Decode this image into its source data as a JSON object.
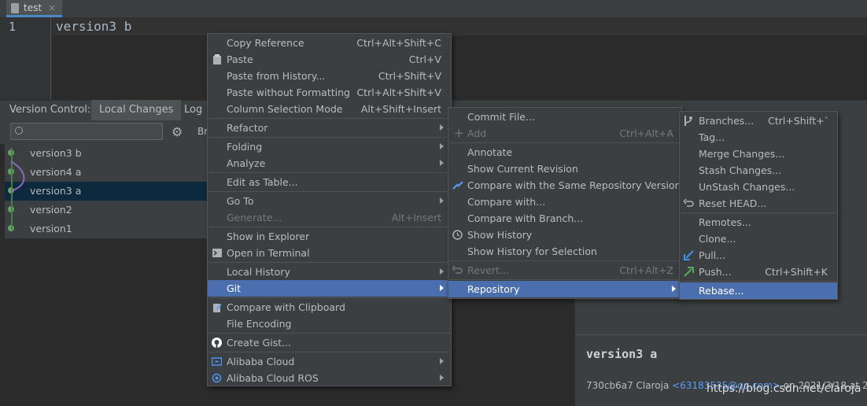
{
  "editor": {
    "tab_title": "test",
    "tab_close": "×",
    "line_number": "1",
    "line_text": "version3 b"
  },
  "version_control": {
    "title": "Version Control:",
    "tabs": [
      "Local Changes",
      "Log"
    ],
    "branch_label": "Br",
    "log": [
      {
        "message": "version3 b"
      },
      {
        "message": "version4 a"
      },
      {
        "message": "version3 a"
      },
      {
        "message": "version2"
      },
      {
        "message": "version1"
      }
    ],
    "details": {
      "title": "version3 a",
      "hash_author": "730cb6a7 Claroja",
      "email": "<63183535@qq.com>",
      "date_text": "on 2021/3/18 at 22:4"
    },
    "watermark": "https://blog.csdn.net/claroja"
  },
  "menus": {
    "main": [
      {
        "label": "Copy Reference",
        "shortcut": "Ctrl+Alt+Shift+C"
      },
      {
        "label": "Paste",
        "shortcut": "Ctrl+V",
        "icon": "clipboard-icon"
      },
      {
        "label": "Paste from History...",
        "shortcut": "Ctrl+Shift+V"
      },
      {
        "label": "Paste without Formatting",
        "shortcut": "Ctrl+Alt+Shift+V"
      },
      {
        "label": "Column Selection Mode",
        "shortcut": "Alt+Shift+Insert"
      },
      {
        "label": "Refactor",
        "submenu": true
      },
      {
        "label": "Folding",
        "submenu": true
      },
      {
        "label": "Analyze",
        "submenu": true
      },
      {
        "label": "Edit as Table..."
      },
      {
        "label": "Go To",
        "submenu": true
      },
      {
        "label": "Generate...",
        "shortcut": "Alt+Insert",
        "disabled": true
      },
      {
        "label": "Show in Explorer"
      },
      {
        "label": "Open in Terminal",
        "icon": "terminal-icon"
      },
      {
        "label": "Local History",
        "submenu": true
      },
      {
        "label": "Git",
        "submenu": true,
        "selected": true
      },
      {
        "label": "Compare with Clipboard",
        "icon": "compare-clipboard-icon"
      },
      {
        "label": "File Encoding"
      },
      {
        "label": "Create Gist...",
        "icon": "github-icon"
      },
      {
        "label": "Alibaba Cloud",
        "submenu": true,
        "icon": "alibaba-cloud-icon"
      },
      {
        "label": "Alibaba Cloud ROS",
        "submenu": true,
        "icon": "alibaba-ros-icon"
      }
    ],
    "git": [
      {
        "label": "Commit File..."
      },
      {
        "label": "Add",
        "shortcut": "Ctrl+Alt+A",
        "disabled": true,
        "icon": "plus-icon"
      },
      {
        "label": "Annotate"
      },
      {
        "label": "Show Current Revision"
      },
      {
        "label": "Compare with the Same Repository Version",
        "icon": "compare-icon"
      },
      {
        "label": "Compare with..."
      },
      {
        "label": "Compare with Branch..."
      },
      {
        "label": "Show History",
        "icon": "clock-icon"
      },
      {
        "label": "Show History for Selection"
      },
      {
        "label": "Revert...",
        "shortcut": "Ctrl+Alt+Z",
        "disabled": true,
        "icon": "revert-icon"
      },
      {
        "label": "Repository",
        "submenu": true,
        "selected": true
      }
    ],
    "repository": [
      {
        "label": "Branches...",
        "shortcut": "Ctrl+Shift+`",
        "icon": "branch-icon"
      },
      {
        "label": "Tag..."
      },
      {
        "label": "Merge Changes..."
      },
      {
        "label": "Stash Changes..."
      },
      {
        "label": "UnStash Changes..."
      },
      {
        "label": "Reset HEAD...",
        "icon": "undo-icon"
      },
      {
        "label": "Remotes..."
      },
      {
        "label": "Clone..."
      },
      {
        "label": "Pull...",
        "icon": "pull-arrow-icon"
      },
      {
        "label": "Push...",
        "shortcut": "Ctrl+Shift+K",
        "icon": "push-arrow-icon"
      },
      {
        "label": "Rebase...",
        "selected": true
      }
    ]
  },
  "colors": {
    "selection": "#4b6eaf",
    "menu_bg": "#3c3f41",
    "editor_bg": "#2b2b2b",
    "graph_green": "#5fa65f",
    "graph_purple": "#8a6bb8",
    "link": "#589df6"
  }
}
